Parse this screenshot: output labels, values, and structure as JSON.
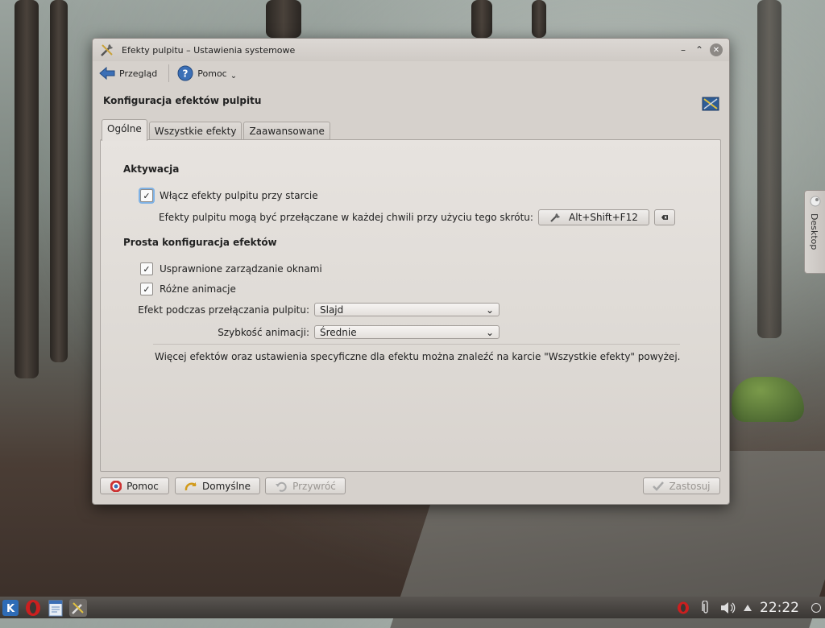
{
  "window": {
    "title": "Efekty pulpitu – Ustawienia systemowe"
  },
  "toolbar": {
    "overview_label": "Przegląd",
    "help_label": "Pomoc"
  },
  "page": {
    "heading": "Konfiguracja efektów pulpitu"
  },
  "tabs": [
    {
      "label": "Ogólne",
      "active": true
    },
    {
      "label": "Wszystkie efekty",
      "active": false
    },
    {
      "label": "Zaawansowane",
      "active": false
    }
  ],
  "activation": {
    "title": "Aktywacja",
    "enable_label": "Włącz efekty pulpitu przy starcie",
    "enable_checked": true,
    "shortcut_text": "Efekty pulpitu mogą być przełączane w każdej chwili przy użyciu tego skrótu:",
    "shortcut_value": "Alt+Shift+F12"
  },
  "simple": {
    "title": "Prosta konfiguracja efektów",
    "window_mgmt_label": "Usprawnione zarządzanie oknami",
    "window_mgmt_checked": true,
    "animations_label": "Różne animacje",
    "animations_checked": true,
    "switch_effect_label": "Efekt podczas przełączania pulpitu:",
    "switch_effect_value": "Slajd",
    "anim_speed_label": "Szybkość animacji:",
    "anim_speed_value": "Średnie",
    "info_text": "Więcej efektów oraz ustawienia specyficzne dla efektu można znaleźć na karcie \"Wszystkie efekty\" powyżej."
  },
  "buttons": {
    "help": "Pomoc",
    "defaults": "Domyślne",
    "reset": "Przywróć",
    "apply": "Zastosuj"
  },
  "desktop_widget": {
    "label": "Desktop"
  },
  "taskbar": {
    "clock": "22:22"
  },
  "colors": {
    "accent": "#3b6fb6",
    "window_bg": "#d6d1cc",
    "taskbar": "#3a3734"
  }
}
